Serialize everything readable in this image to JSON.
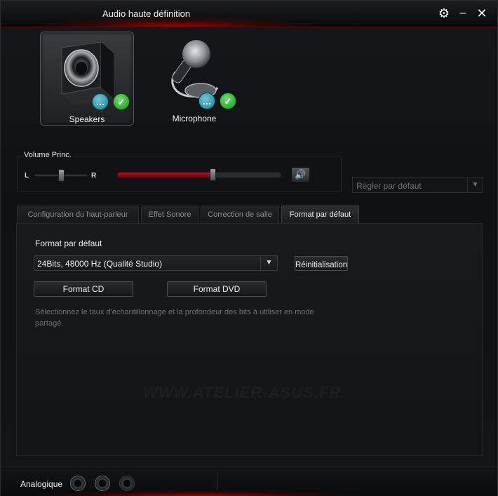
{
  "window": {
    "title": "Audio haute définition",
    "settings_icon": "gear-icon",
    "minimize_icon": "minimize-icon",
    "close_icon": "close-icon"
  },
  "devices": [
    {
      "label": "Speakers",
      "icon": "speaker-icon",
      "selected": true
    },
    {
      "label": "Microphone",
      "icon": "microphone-icon",
      "selected": false
    }
  ],
  "volume": {
    "title": "Volume Princ.",
    "left_label": "L",
    "right_label": "R",
    "balance": 0.5,
    "level": 0.58,
    "mute_icon": "speaker-volume-icon"
  },
  "default_select": {
    "value": "Régler par défaut"
  },
  "tabs": [
    {
      "label": "Configuration du haut-parleur",
      "active": false
    },
    {
      "label": "Effet Sonore",
      "active": false
    },
    {
      "label": "Correction de salle",
      "active": false
    },
    {
      "label": "Format par défaut",
      "active": true
    }
  ],
  "format": {
    "label": "Format par défaut",
    "selected": "24Bits, 48000 Hz (Qualité Studio)",
    "reset_label": "Réinitialisation",
    "cd_label": "Format CD",
    "dvd_label": "Format DVD",
    "description": "Sélectionnez le taux d'échantillonnage et la profondeur des bits à utiliser en mode partagé."
  },
  "watermark": "WWW.ATELIER-ASUS.FR",
  "bottom": {
    "analog_label": "Analogique"
  },
  "colors": {
    "accent_red": "#b0121a",
    "ok_green": "#1c8f1c",
    "info_teal": "#1f7f95"
  }
}
